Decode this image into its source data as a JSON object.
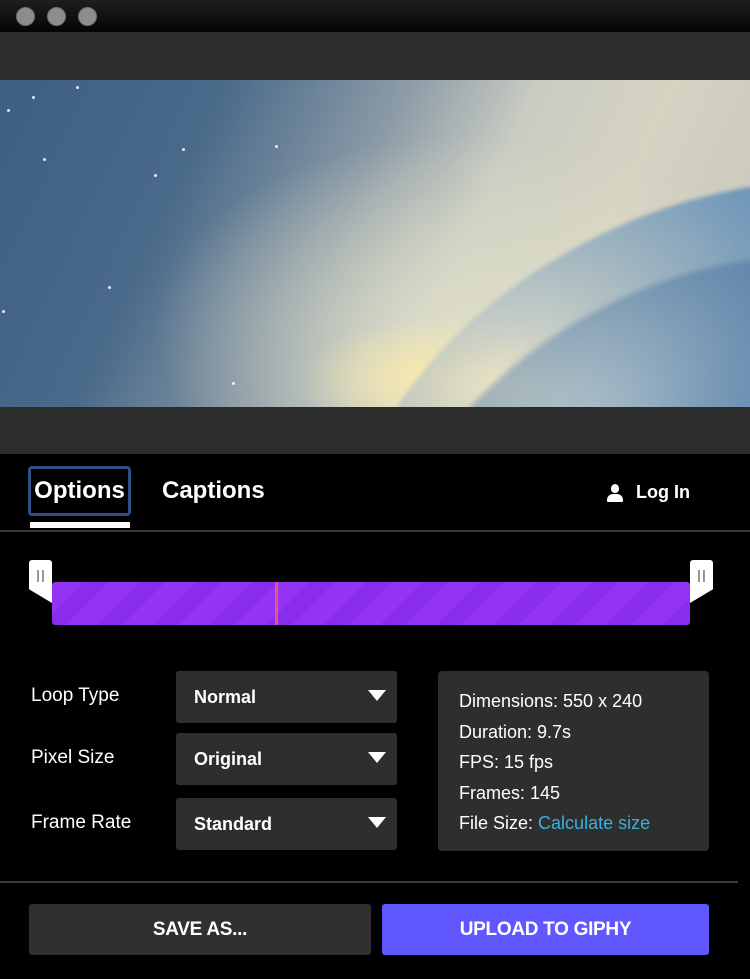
{
  "window": {
    "controls": [
      "close",
      "minimize",
      "zoom"
    ]
  },
  "preview": {
    "image_description": "galaxy wallpaper"
  },
  "tabs": [
    {
      "label": "Options",
      "active": true
    },
    {
      "label": "Captions",
      "active": false
    }
  ],
  "account": {
    "login_label": "Log In",
    "icon": "user-icon"
  },
  "trimmer": {
    "playhead_progress": 0.35,
    "trim_start": 0.0,
    "trim_end": 1.0,
    "colors": {
      "bar": "#9334f5",
      "playhead": "#e8567a"
    }
  },
  "settings": [
    {
      "label": "Loop Type",
      "value": "Normal"
    },
    {
      "label": "Pixel Size",
      "value": "Original"
    },
    {
      "label": "Frame Rate",
      "value": "Standard"
    }
  ],
  "info": {
    "dimensions": "Dimensions: 550 x 240",
    "duration": "Duration: 9.7s",
    "fps": "FPS: 15 fps",
    "frames": "Frames: 145",
    "file_size_label": "File Size:",
    "file_size_link": "Calculate size"
  },
  "actions": {
    "save_label": "SAVE AS...",
    "upload_label": "UPLOAD TO GIPHY",
    "upload_color": "#6157ff"
  }
}
